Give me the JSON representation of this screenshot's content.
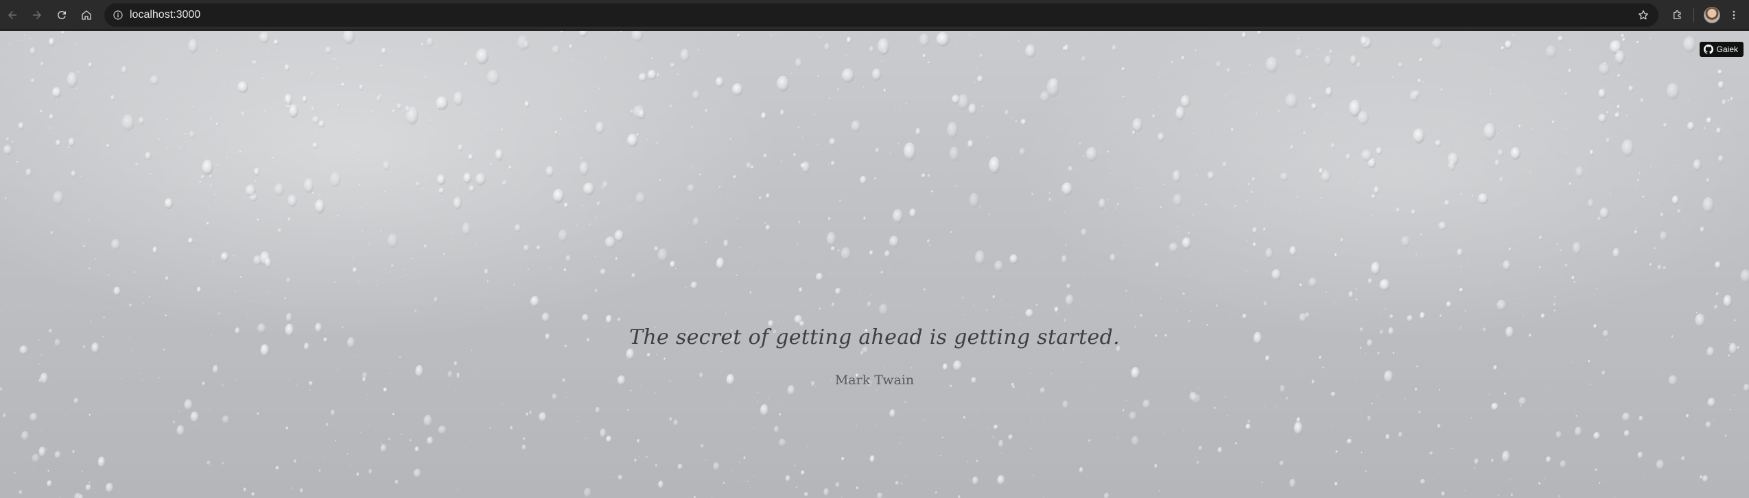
{
  "browser": {
    "url": "localhost:3000",
    "icons": {
      "back": "arrow-left-icon",
      "forward": "arrow-right-icon",
      "reload": "reload-icon",
      "home": "home-icon",
      "site_info": "info-icon",
      "bookmark": "star-icon",
      "extensions": "puzzle-icon",
      "menu": "kebab-menu-icon"
    }
  },
  "page": {
    "github_badge": {
      "label": "Gaiek",
      "icon": "github-icon"
    },
    "quote": {
      "text": "The secret of getting ahead is getting started.",
      "author": "Mark Twain"
    }
  },
  "colors": {
    "toolbar": "#2b2b2b",
    "omnibox": "#1c1c1c",
    "badge": "#111111",
    "quote_text": "#3f3f3f",
    "author_text": "#5a5a5a"
  }
}
